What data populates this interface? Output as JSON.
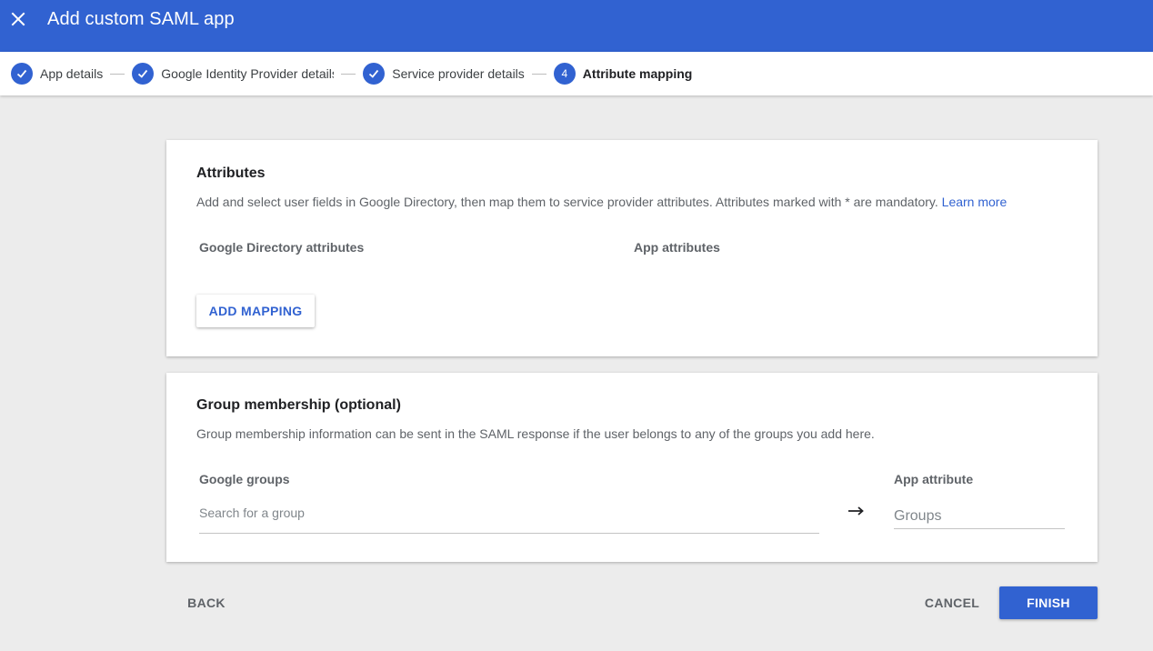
{
  "header": {
    "title": "Add custom SAML app",
    "close_icon": "close-icon"
  },
  "stepper": {
    "steps": [
      {
        "label": "App details",
        "state": "completed",
        "icon": "check-icon"
      },
      {
        "label": "Google Identity Provider details",
        "state": "completed",
        "icon": "check-icon"
      },
      {
        "label": "Service provider details",
        "state": "completed",
        "icon": "check-icon"
      },
      {
        "label": "Attribute mapping",
        "state": "active",
        "number": "4"
      }
    ]
  },
  "attributes": {
    "title": "Attributes",
    "description": "Add and select user fields in Google Directory, then map them to service provider attributes. Attributes marked with * are mandatory.",
    "learn_more": "Learn more",
    "col_directory": "Google Directory attributes",
    "col_app": "App attributes",
    "add_mapping": "ADD MAPPING"
  },
  "group_membership": {
    "title": "Group membership (optional)",
    "description": "Group membership information can be sent in the SAML response if the user belongs to any of the groups you add here.",
    "col_groups": "Google groups",
    "search_placeholder": "Search for a group",
    "col_app_attribute": "App attribute",
    "app_attribute_placeholder": "Groups",
    "arrow_icon": "arrow-right-icon"
  },
  "footer": {
    "back": "BACK",
    "cancel": "CANCEL",
    "finish": "FINISH"
  },
  "colors": {
    "brand": "#3162d1",
    "background": "#ececec",
    "card": "#ffffff"
  }
}
